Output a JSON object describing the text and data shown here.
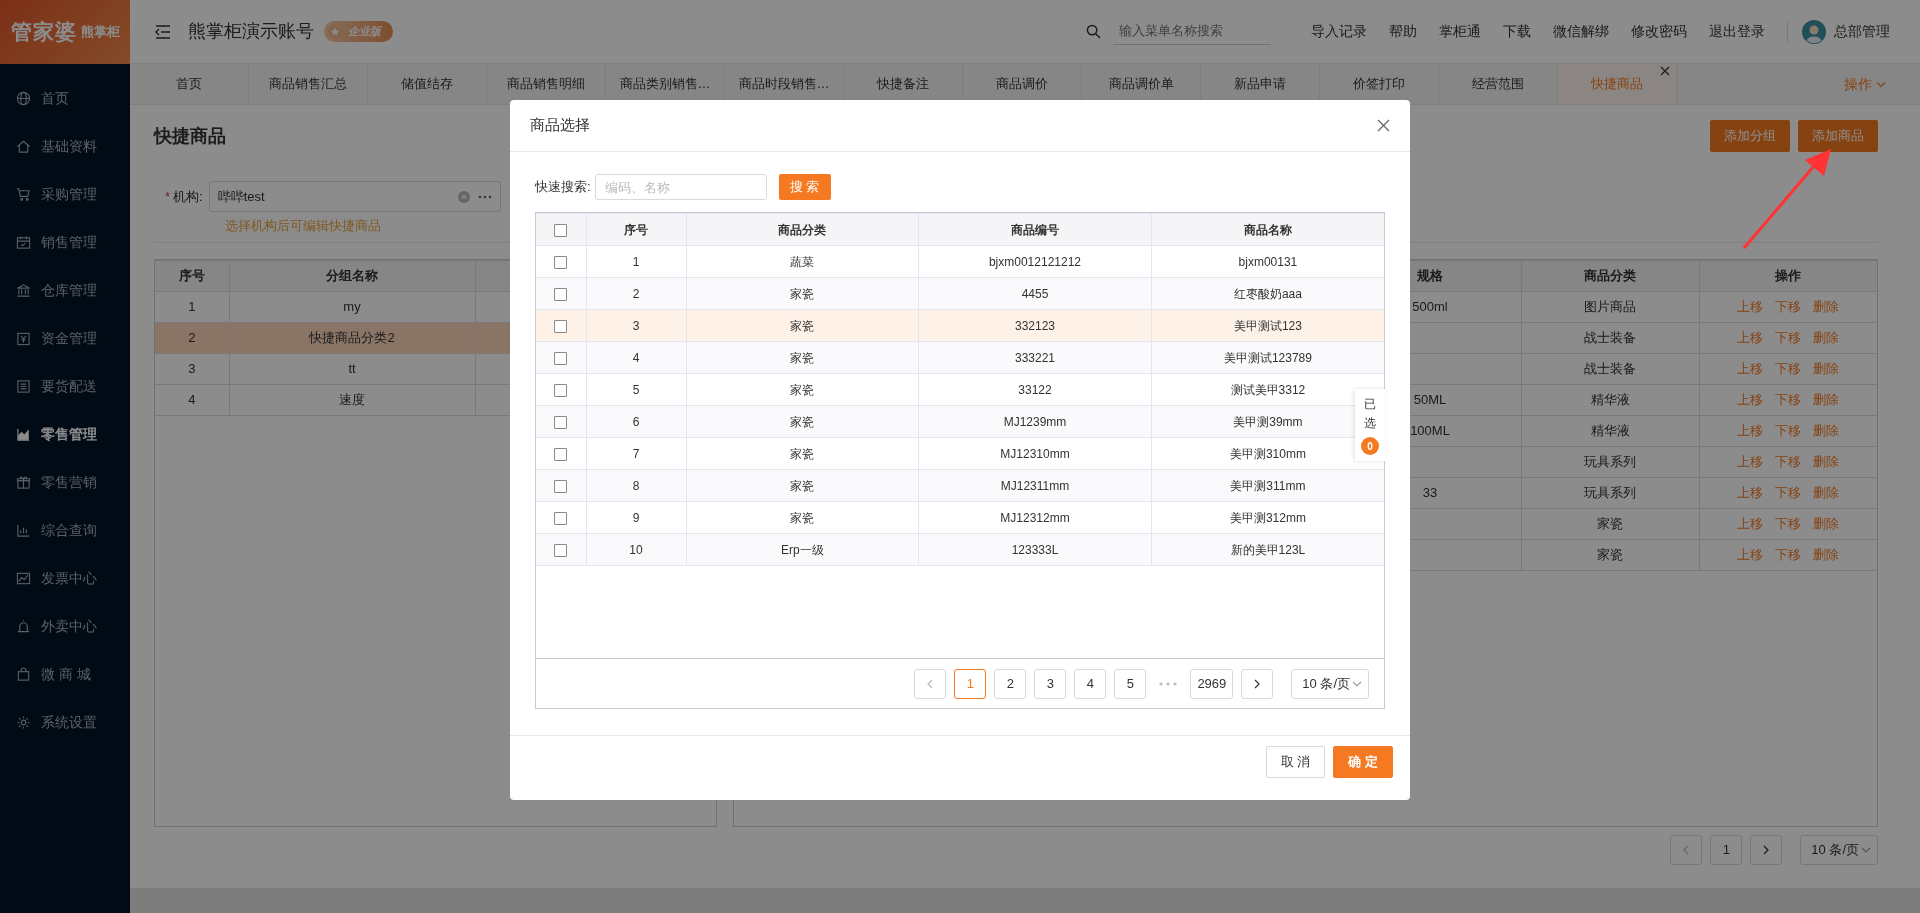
{
  "logo": {
    "brand": "管家婆",
    "sub": "熊掌柜"
  },
  "sidebar": {
    "items": [
      {
        "label": "首页",
        "selected": false
      },
      {
        "label": "基础资料",
        "selected": false
      },
      {
        "label": "采购管理",
        "selected": false
      },
      {
        "label": "销售管理",
        "selected": false
      },
      {
        "label": "仓库管理",
        "selected": false
      },
      {
        "label": "资金管理",
        "selected": false
      },
      {
        "label": "要货配送",
        "selected": false
      },
      {
        "label": "零售管理",
        "selected": true
      },
      {
        "label": "零售营销",
        "selected": false
      },
      {
        "label": "综合查询",
        "selected": false
      },
      {
        "label": "发票中心",
        "selected": false
      },
      {
        "label": "外卖中心",
        "selected": false
      },
      {
        "label": "微 商 城",
        "selected": false
      },
      {
        "label": "系统设置",
        "selected": false
      }
    ]
  },
  "header": {
    "title": "熊掌柜演示账号",
    "edition_badge": "企业版",
    "search": {
      "placeholder": "输入菜单名称搜索"
    },
    "links": [
      "导入记录",
      "帮助",
      "掌柜通",
      "下载",
      "微信解绑",
      "修改密码",
      "退出登录"
    ],
    "user": "总部管理"
  },
  "tabs": [
    {
      "label": "首页",
      "selected": false,
      "closable": false
    },
    {
      "label": "商品销售汇总",
      "selected": false,
      "closable": false
    },
    {
      "label": "储值结存",
      "selected": false,
      "closable": false
    },
    {
      "label": "商品销售明细",
      "selected": false,
      "closable": false
    },
    {
      "label": "商品类别销售…",
      "selected": false,
      "closable": false
    },
    {
      "label": "商品时段销售…",
      "selected": false,
      "closable": false
    },
    {
      "label": "快捷备注",
      "selected": false,
      "closable": false
    },
    {
      "label": "商品调价",
      "selected": false,
      "closable": false
    },
    {
      "label": "商品调价单",
      "selected": false,
      "closable": false
    },
    {
      "label": "新品申请",
      "selected": false,
      "closable": false
    },
    {
      "label": "价签打印",
      "selected": false,
      "closable": false
    },
    {
      "label": "经营范围",
      "selected": false,
      "closable": false
    },
    {
      "label": "快捷商品",
      "selected": true,
      "closable": true
    }
  ],
  "tab_menu": "操作",
  "page": {
    "title": "快捷商品",
    "buttons": [
      "添加分组",
      "添加商品"
    ],
    "filter": {
      "required_mark": "*",
      "label": "机构:",
      "value": "哔哔test",
      "hint": "选择机构后可编辑快捷商品"
    },
    "group_table": {
      "columns": [
        "序号",
        "分组名称"
      ],
      "rows": [
        {
          "cells": [
            "1",
            "my"
          ],
          "selected": false
        },
        {
          "cells": [
            "2",
            "快捷商品分类2"
          ],
          "selected": true
        },
        {
          "cells": [
            "3",
            "tt"
          ],
          "selected": false
        },
        {
          "cells": [
            "4",
            "速度"
          ],
          "selected": false
        }
      ]
    },
    "product_table": {
      "columns": [
        "规格",
        "商品分类",
        "操作"
      ],
      "rows": [
        {
          "spec": "500ml",
          "category": "图片商品",
          "actions": [
            "上移",
            "下移",
            "删除"
          ]
        },
        {
          "spec": "",
          "category": "战士装备",
          "actions": [
            "上移",
            "下移",
            "删除"
          ]
        },
        {
          "spec": "",
          "category": "战士装备",
          "actions": [
            "上移",
            "下移",
            "删除"
          ]
        },
        {
          "spec": "50ML",
          "category": "精华液",
          "actions": [
            "上移",
            "下移",
            "删除"
          ]
        },
        {
          "spec": "100ML",
          "category": "精华液",
          "actions": [
            "上移",
            "下移",
            "删除"
          ]
        },
        {
          "spec": "",
          "category": "玩具系列",
          "actions": [
            "上移",
            "下移",
            "删除"
          ]
        },
        {
          "spec": "33",
          "category": "玩具系列",
          "actions": [
            "上移",
            "下移",
            "删除"
          ]
        },
        {
          "spec": "",
          "category": "家瓷",
          "actions": [
            "上移",
            "下移",
            "删除"
          ]
        },
        {
          "spec": "",
          "category": "家瓷",
          "actions": [
            "上移",
            "下移",
            "删除"
          ]
        }
      ]
    },
    "pagination": {
      "prev_disabled": true,
      "pages": [
        {
          "label": "1",
          "selected": false
        }
      ],
      "page_size": "10 条/页"
    }
  },
  "dialog": {
    "title": "商品选择",
    "search_label": "快速搜索:",
    "search": {
      "placeholder": "编码、名称"
    },
    "search_button": "搜 索",
    "table": {
      "select_all_checked": false,
      "columns": [
        "序号",
        "商品分类",
        "商品编号",
        "商品名称"
      ],
      "rows": [
        {
          "checked": false,
          "highlighted": false,
          "cells": [
            "1",
            "蔬菜",
            "bjxm0012121212",
            "bjxm00131"
          ]
        },
        {
          "checked": false,
          "highlighted": false,
          "cells": [
            "2",
            "家瓷",
            "4455",
            "红枣酸奶aaa"
          ]
        },
        {
          "checked": false,
          "highlighted": true,
          "cells": [
            "3",
            "家瓷",
            "332123",
            "美甲测试123"
          ]
        },
        {
          "checked": false,
          "highlighted": false,
          "cells": [
            "4",
            "家瓷",
            "333221",
            "美甲测试123789"
          ]
        },
        {
          "checked": false,
          "highlighted": false,
          "cells": [
            "5",
            "家瓷",
            "33122",
            "测试美甲3312"
          ]
        },
        {
          "checked": false,
          "highlighted": false,
          "cells": [
            "6",
            "家瓷",
            "MJ1239mm",
            "美甲测39mm"
          ]
        },
        {
          "checked": false,
          "highlighted": false,
          "cells": [
            "7",
            "家瓷",
            "MJ12310mm",
            "美甲测310mm"
          ]
        },
        {
          "checked": false,
          "highlighted": false,
          "cells": [
            "8",
            "家瓷",
            "MJ12311mm",
            "美甲测311mm"
          ]
        },
        {
          "checked": false,
          "highlighted": false,
          "cells": [
            "9",
            "家瓷",
            "MJ12312mm",
            "美甲测312mm"
          ]
        },
        {
          "checked": false,
          "highlighted": false,
          "cells": [
            "10",
            "Erp一级",
            "123333L",
            "新的美甲123L"
          ]
        }
      ]
    },
    "selected_tab": {
      "label": "已选",
      "count": "0"
    },
    "pagination": {
      "prev_disabled": true,
      "pages": [
        {
          "label": "1",
          "selected": true
        },
        {
          "label": "2",
          "selected": false
        },
        {
          "label": "3",
          "selected": false
        },
        {
          "label": "4",
          "selected": false
        },
        {
          "label": "5",
          "selected": false
        },
        {
          "label": "2969",
          "selected": false,
          "gap_before": true
        }
      ],
      "page_size": "10 条/页"
    },
    "buttons": [
      {
        "label": "取 消",
        "primary": false
      },
      {
        "label": "确 定",
        "primary": true
      }
    ]
  }
}
